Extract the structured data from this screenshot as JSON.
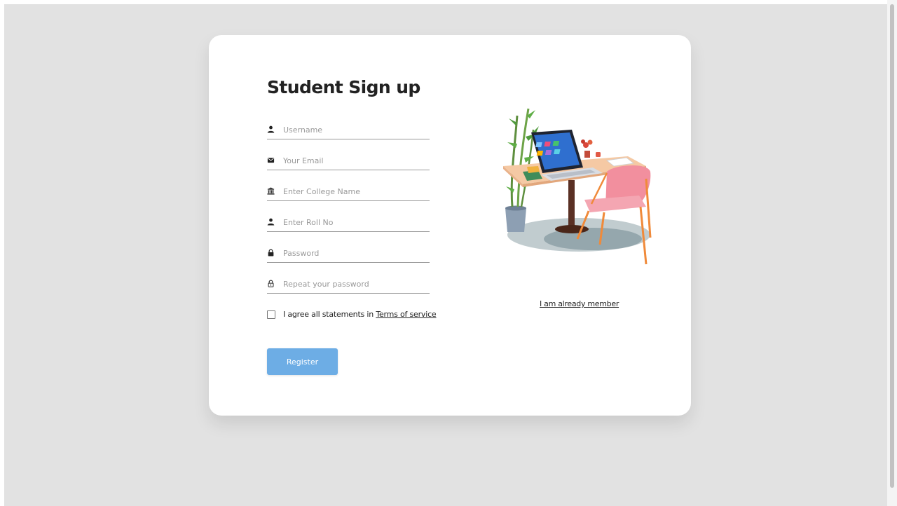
{
  "signup": {
    "title": "Student Sign up",
    "fields": [
      {
        "icon": "user-icon",
        "placeholder": "Username",
        "value": ""
      },
      {
        "icon": "envelope-icon",
        "placeholder": "Your Email",
        "value": ""
      },
      {
        "icon": "college-icon",
        "placeholder": "Enter College Name",
        "value": ""
      },
      {
        "icon": "user-icon",
        "placeholder": "Enter Roll No",
        "value": ""
      },
      {
        "icon": "lock-icon",
        "placeholder": "Password",
        "value": ""
      },
      {
        "icon": "lock-outline-icon",
        "placeholder": "Repeat your password",
        "value": ""
      }
    ],
    "agree_text": "I agree all statements in ",
    "terms_link": "Terms of service",
    "agree_checked": false,
    "register_label": "Register",
    "member_link": "I am already member"
  },
  "colors": {
    "page_background": "#e2e2e2",
    "card_background": "#ffffff",
    "button": "#6dade5",
    "button_text": "#ffffff",
    "title": "#222222"
  },
  "illustration": {
    "icon": "desk-laptop-chair-plant-illustration"
  }
}
